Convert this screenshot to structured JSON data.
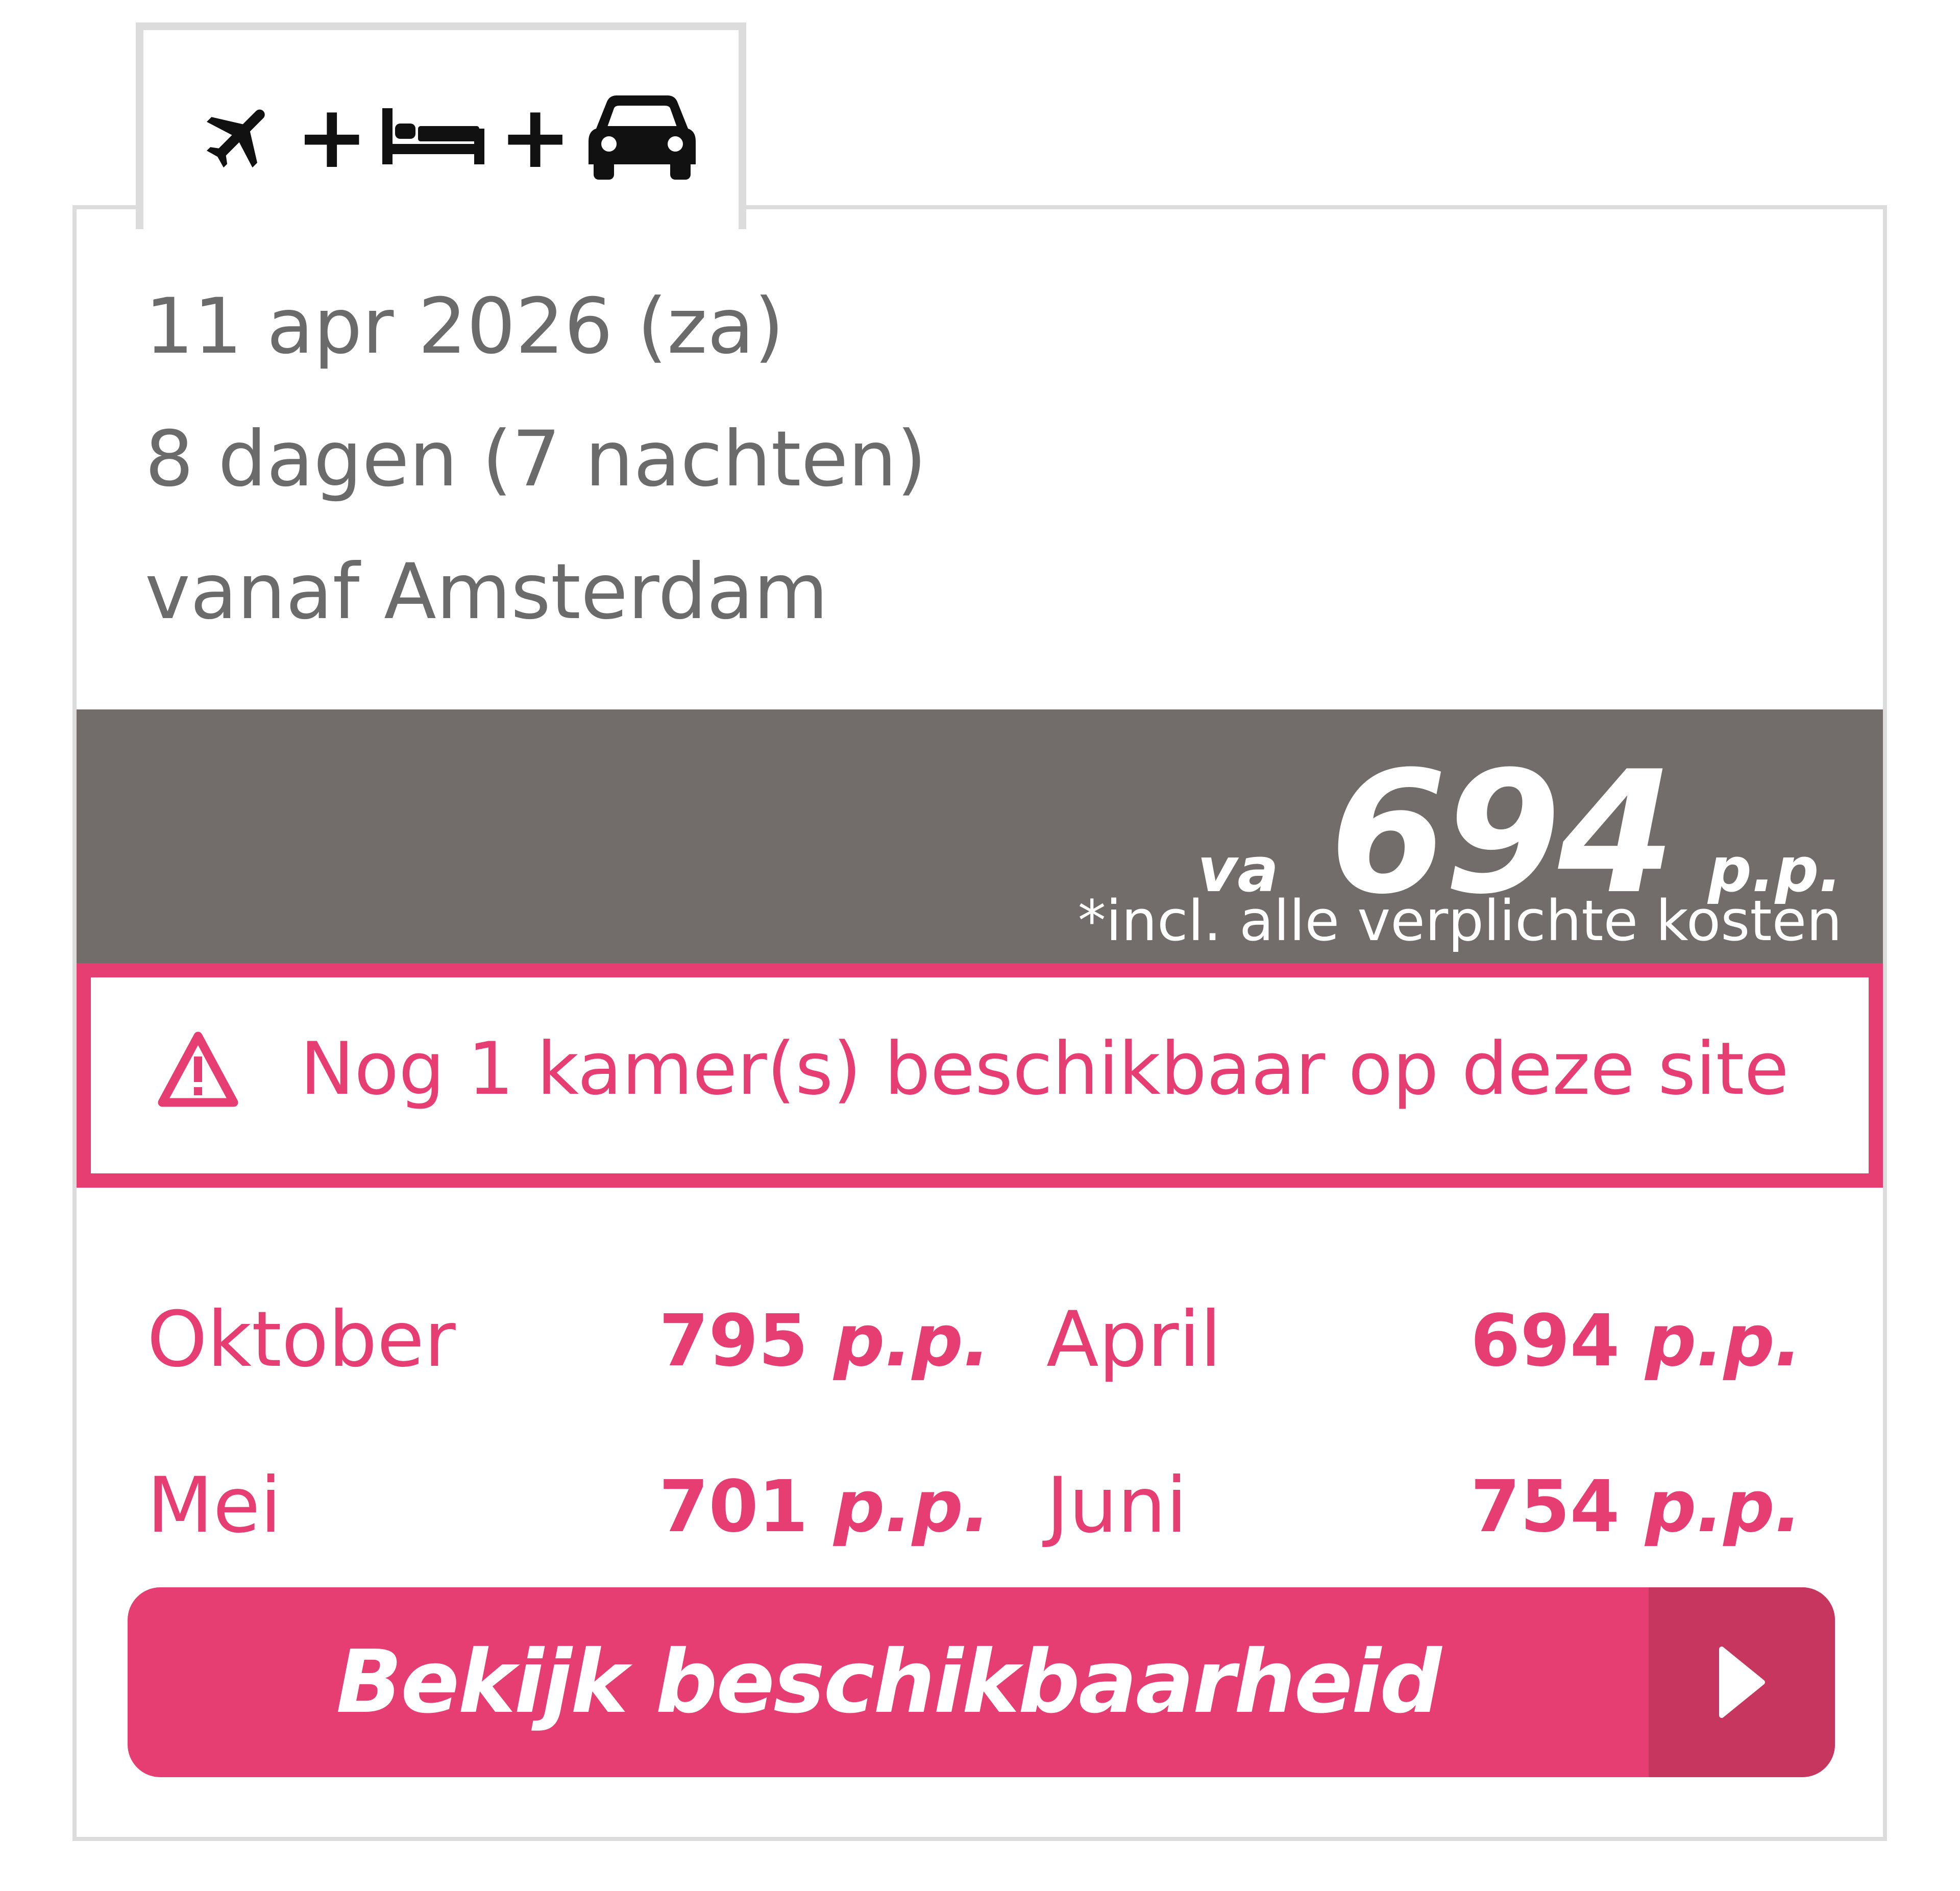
{
  "tab": {
    "icons": [
      "airplane-icon",
      "bed-icon",
      "car-icon"
    ],
    "plus_1": "+",
    "plus_2": "+"
  },
  "trip": {
    "date": "11 apr 2026 (za)",
    "duration": "8 dagen (7 nachten)",
    "departure": "vanaf Amsterdam"
  },
  "price": {
    "prefix": "va",
    "amount": "694",
    "unit": "p.p.",
    "note": "*incl. alle verplichte kosten"
  },
  "alert": {
    "icon": "warning-icon",
    "text": "Nog 1 kamer(s) beschikbaar op deze site"
  },
  "months": [
    {
      "name": "Oktober",
      "price": "795",
      "unit": "p.p."
    },
    {
      "name": "April",
      "price": "694",
      "unit": "p.p."
    },
    {
      "name": "Mei",
      "price": "701",
      "unit": "p.p."
    },
    {
      "name": "Juni",
      "price": "754",
      "unit": "p.p."
    }
  ],
  "cta": {
    "label": "Bekijk beschikbaarheid",
    "icon": "play-arrow-icon"
  },
  "colors": {
    "accent": "#e63d72",
    "accent_dark": "#c6365f",
    "price_bar": "#726d6a",
    "text_gray": "#6b6b6b",
    "border_gray": "#dcdcdc"
  }
}
